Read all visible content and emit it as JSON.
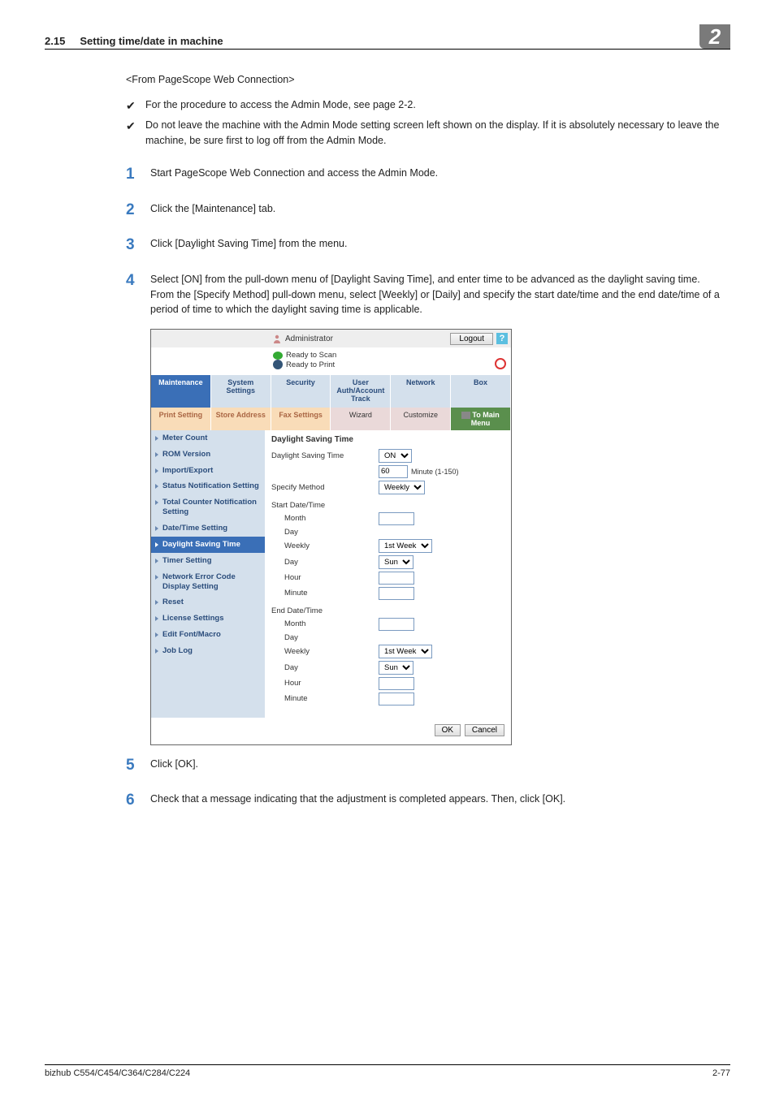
{
  "header": {
    "section_num": "2.15",
    "section_title": "Setting time/date in machine",
    "chapter_badge": "2"
  },
  "text": {
    "from_line": "<From PageScope Web Connection>",
    "bullets": [
      "For the procedure to access the Admin Mode, see page 2-2.",
      "Do not leave the machine with the Admin Mode setting screen left shown on the display. If it is absolutely necessary to leave the machine, be sure first to log off from the Admin Mode."
    ],
    "steps": {
      "1": "Start PageScope Web Connection and access the Admin Mode.",
      "2": "Click the [Maintenance] tab.",
      "3": "Click [Daylight Saving Time] from the menu.",
      "4a": "Select [ON] from the pull-down menu of [Daylight Saving Time], and enter time to be advanced as the daylight saving time.",
      "4b": "From the [Specify Method] pull-down menu, select [Weekly] or [Daily] and specify the start date/time and the end date/time of a period of time to which the daylight saving time is applicable.",
      "5": "Click [OK].",
      "6": "Check that a message indicating that the adjustment is completed appears. Then, click [OK]."
    }
  },
  "ps": {
    "top": {
      "admin": "Administrator",
      "logout": "Logout"
    },
    "status": {
      "scan": "Ready to Scan",
      "print": "Ready to Print"
    },
    "tabs": [
      "Maintenance",
      "System Settings",
      "Security",
      "User Auth/Account Track",
      "Network",
      "Box"
    ],
    "subtabs": [
      "Print Setting",
      "Store Address",
      "Fax Settings",
      "Wizard",
      "Customize",
      "To Main Menu"
    ],
    "side": [
      "Meter Count",
      "ROM Version",
      "Import/Export",
      "Status Notification Setting",
      "Total Counter Notification Setting",
      "Date/Time Setting",
      "Daylight Saving Time",
      "Timer Setting",
      "Network Error Code Display Setting",
      "Reset",
      "License Settings",
      "Edit Font/Macro",
      "Job Log"
    ],
    "main": {
      "title": "Daylight Saving Time",
      "rows": {
        "dst_label": "Daylight Saving Time",
        "dst_value": "ON",
        "minute_value": "60",
        "minute_range": "Minute (1-150)",
        "specify_label": "Specify Method",
        "specify_value": "Weekly",
        "start_head": "Start Date/Time",
        "end_head": "End Date/Time",
        "month": "Month",
        "day": "Day",
        "weekly": "Weekly",
        "weekly_value": "1st Week",
        "dayofweek_value": "Sun",
        "hour": "Hour",
        "minute": "Minute"
      },
      "ok": "OK",
      "cancel": "Cancel"
    }
  },
  "footer": {
    "left": "bizhub C554/C454/C364/C284/C224",
    "right": "2-77"
  }
}
